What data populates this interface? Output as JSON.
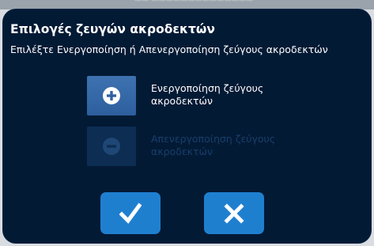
{
  "background_status": {
    "text": "—— ——————————————"
  },
  "dialog": {
    "title": "Επιλογές ζευγών ακροδεκτών",
    "subtitle": "Επιλέξτε Ενεργοποίηση ή Απενεργοποίηση ζεύγους ακροδεκτών"
  },
  "options": {
    "enable": {
      "label": "Ενεργοποίηση ζεύγους ακροδεκτών",
      "icon": "plus-circle-icon",
      "enabled": true
    },
    "disable": {
      "label": "Απενεργοποίηση ζεύγους ακροδεκτών",
      "icon": "minus-circle-icon",
      "enabled": false
    }
  },
  "actions": {
    "confirm": {
      "icon": "checkmark-icon"
    },
    "cancel": {
      "icon": "x-icon"
    }
  },
  "colors": {
    "dialog_background": "#031a35",
    "option_button": "#3a6ca8",
    "option_button_disabled": "#0d2d52",
    "action_button": "#1f7fcf",
    "text_primary": "#ffffff",
    "text_disabled": "#183e6b"
  }
}
